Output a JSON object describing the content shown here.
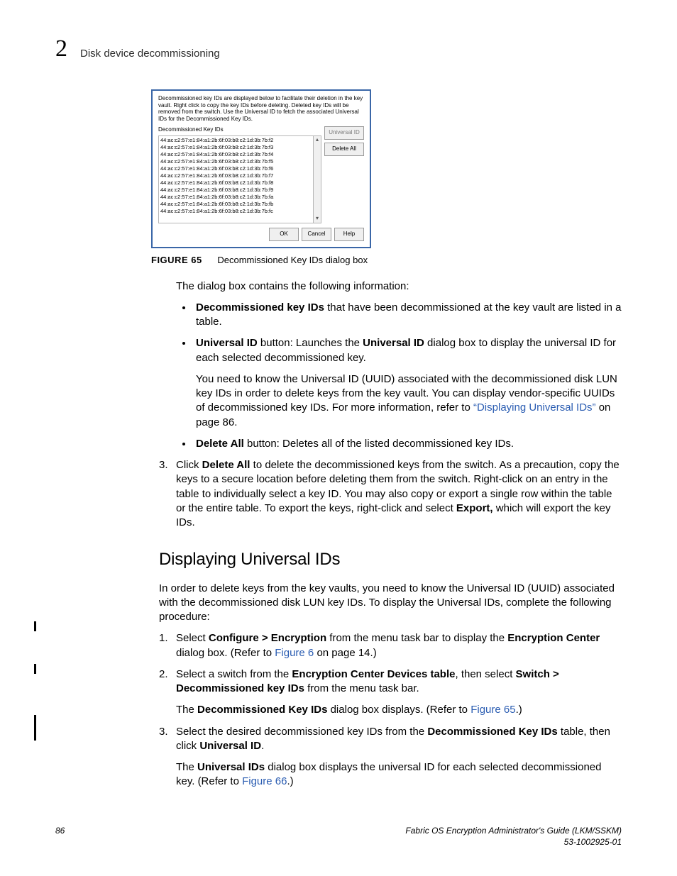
{
  "header": {
    "chapter_number": "2",
    "running_title": "Disk device decommissioning"
  },
  "dialog": {
    "intro": "Decommissioned key IDs are displayed below to facilitate their deletion in the key vault. Right click to copy the key IDs before deleting. Deleted key IDs will be removed from the switch. Use the Universal ID to fetch the associated Universal IDs for the Decommissioned Key IDs.",
    "list_header": "Decommissioned Key IDs",
    "ids": [
      "44:ac:c2:57:e1:84:a1:2b:6f:03:b8:c2:1d:3b:7b:f2",
      "44:ac:c2:57:e1:84:a1:2b:6f:03:b8:c2:1d:3b:7b:f3",
      "44:ac:c2:57:e1:84:a1:2b:6f:03:b8:c2:1d:3b:7b:f4",
      "44:ac:c2:57:e1:84:a1:2b:6f:03:b8:c2:1d:3b:7b:f5",
      "44:ac:c2:57:e1:84:a1:2b:6f:03:b8:c2:1d:3b:7b:f6",
      "44:ac:c2:57:e1:84:a1:2b:6f:03:b8:c2:1d:3b:7b:f7",
      "44:ac:c2:57:e1:84:a1:2b:6f:03:b8:c2:1d:3b:7b:f8",
      "44:ac:c2:57:e1:84:a1:2b:6f:03:b8:c2:1d:3b:7b:f9",
      "44:ac:c2:57:e1:84:a1:2b:6f:03:b8:c2:1d:3b:7b:fa",
      "44:ac:c2:57:e1:84:a1:2b:6f:03:b8:c2:1d:3b:7b:fb",
      "44:ac:c2:57:e1:84:a1:2b:6f:03:b8:c2:1d:3b:7b:fc"
    ],
    "btn_universal": "Universal ID",
    "btn_delete_all": "Delete All",
    "btn_ok": "OK",
    "btn_cancel": "Cancel",
    "btn_help": "Help"
  },
  "figure": {
    "label": "FIGURE 65",
    "caption": "Decommissioned Key IDs dialog box"
  },
  "body": {
    "lead": "The dialog box contains the following information:",
    "bullet1a": "Decommissioned key IDs",
    "bullet1b": " that have been decommissioned at the key vault are listed in a table.",
    "bullet2a": "Universal ID",
    "bullet2b": " button: Launches the ",
    "bullet2c": "Universal ID",
    "bullet2d": " dialog box to display the universal ID for each selected decommissioned key.",
    "bullet2_sub_a": "You need to know the Universal ID (UUID) associated with the decommissioned disk LUN key IDs in order to delete keys from the key vault. You can display vendor-specific UUIDs of decommissioned key IDs. For more information, refer to ",
    "bullet2_sub_link": "“Displaying Universal IDs”",
    "bullet2_sub_b": " on page 86.",
    "bullet3a": "Delete All",
    "bullet3b": " button: Deletes all of the listed decommissioned key IDs.",
    "step3_num": "3.",
    "step3_a": "Click ",
    "step3_b": "Delete All",
    "step3_c": " to delete the decommissioned keys from the switch. As a precaution, copy the keys to a secure location before deleting them from the switch. Right-click on an entry in the table to individually select a key ID. You may also copy or export a single row within the table or the entire table. To export the keys, right-click and select ",
    "step3_d": "Export,",
    "step3_e": " which will export the key IDs."
  },
  "section2": {
    "title": "Displaying Universal IDs",
    "intro": "In order to delete keys from the key vaults, you need to know the Universal ID (UUID) associated with the decommissioned disk LUN key IDs. To display the Universal IDs, complete the following procedure:",
    "s1_num": "1.",
    "s1_a": "Select ",
    "s1_b": "Configure > Encryption",
    "s1_c": " from the menu task bar to display the ",
    "s1_d": "Encryption Center",
    "s1_e": " dialog box. (Refer to ",
    "s1_link": "Figure 6",
    "s1_f": " on page 14.)",
    "s2_num": "2.",
    "s2_a": "Select a switch from the ",
    "s2_b": "Encryption Center Devices table",
    "s2_c": ", then select ",
    "s2_d": "Switch > Decommissioned key IDs",
    "s2_e": " from the menu task bar.",
    "s2_sub_a": "The ",
    "s2_sub_b": "Decommissioned Key IDs",
    "s2_sub_c": " dialog box displays. (Refer to ",
    "s2_sub_link": "Figure 65",
    "s2_sub_d": ".)",
    "s3_num": "3.",
    "s3_a": "Select the desired decommissioned key IDs from the ",
    "s3_b": "Decommissioned Key IDs",
    "s3_c": " table, then click ",
    "s3_d": "Universal ID",
    "s3_e": ".",
    "s3_sub_a": "The ",
    "s3_sub_b": "Universal IDs",
    "s3_sub_c": " dialog box displays the universal ID for each selected decommissioned key. (Refer to ",
    "s3_sub_link": "Figure 66",
    "s3_sub_d": ".)"
  },
  "footer": {
    "page": "86",
    "title": "Fabric OS Encryption Administrator's Guide  (LKM/SSKM)",
    "doc": "53-1002925-01"
  }
}
